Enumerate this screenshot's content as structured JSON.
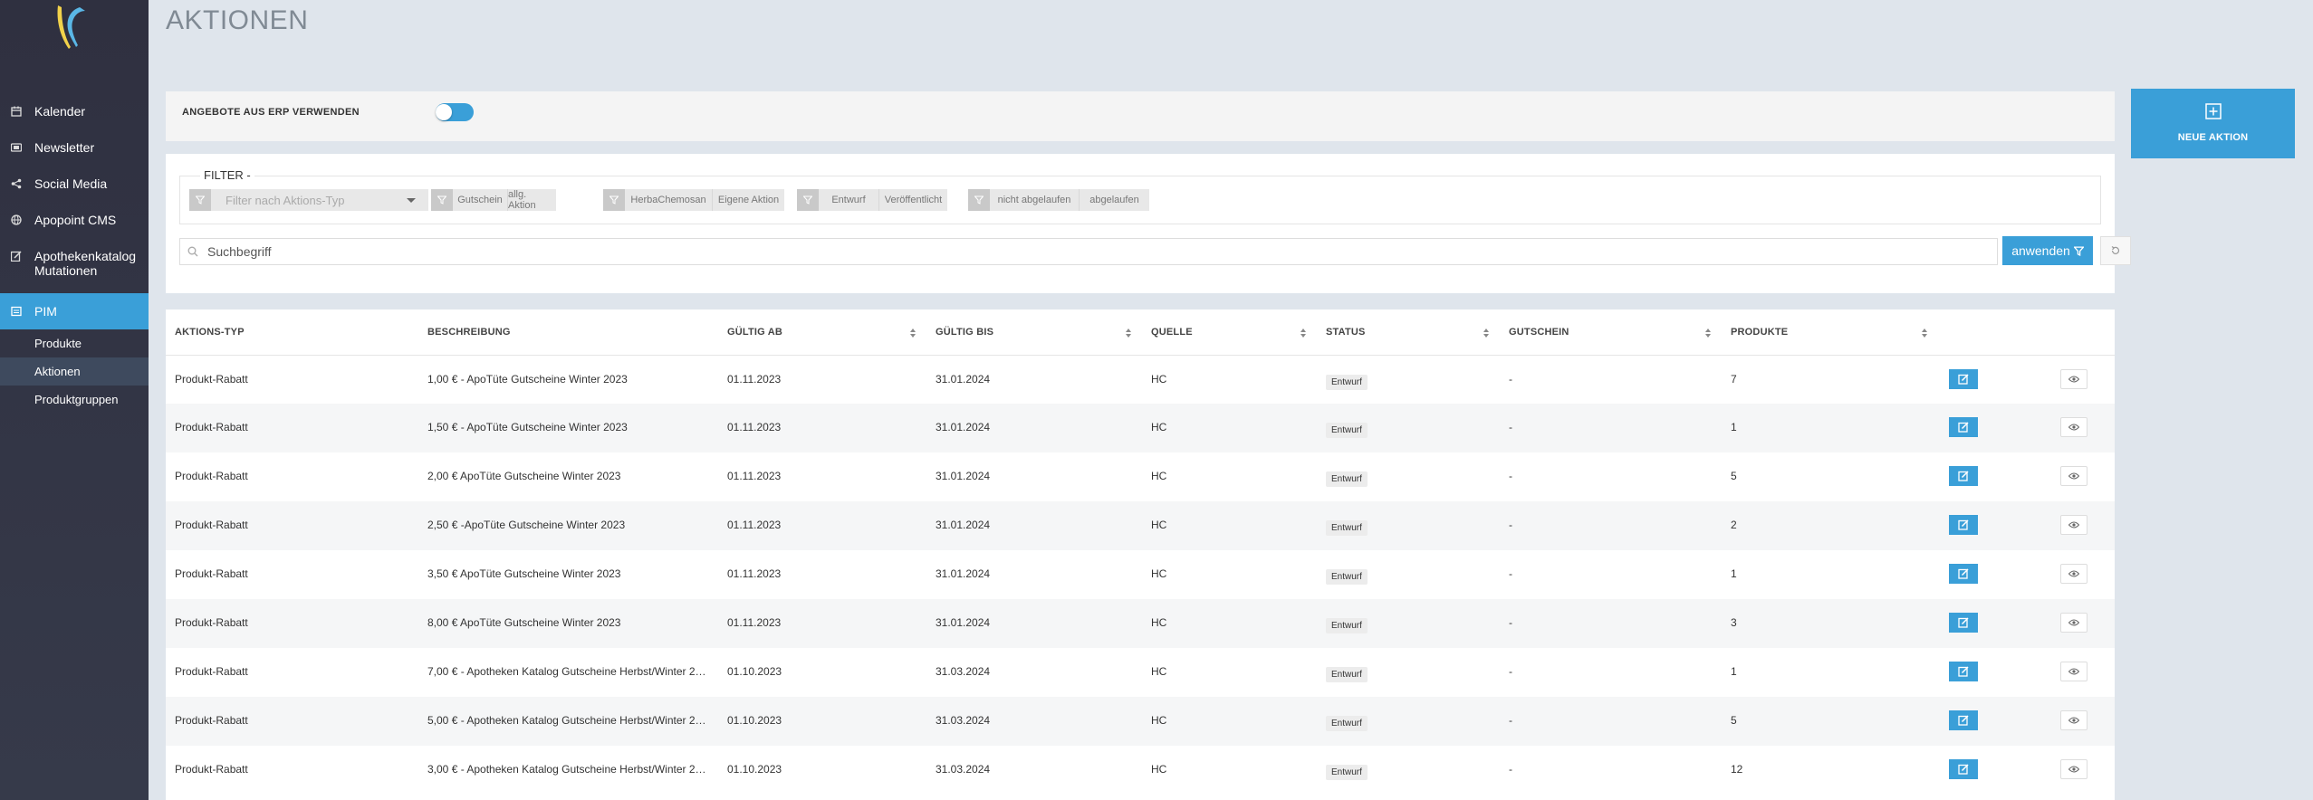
{
  "page": {
    "title": "AKTIONEN"
  },
  "sidebar": {
    "items": [
      {
        "label": "Kalender",
        "icon": "calendar-icon"
      },
      {
        "label": "Newsletter",
        "icon": "newsletter-icon"
      },
      {
        "label": "Social Media",
        "icon": "share-icon"
      },
      {
        "label": "Apopoint CMS",
        "icon": "globe-icon"
      },
      {
        "label": "Apothekenkatalog Mutationen",
        "icon": "edit-icon"
      },
      {
        "label": "PIM",
        "icon": "pim-icon",
        "active": true
      }
    ],
    "subitems": [
      {
        "label": "Produkte"
      },
      {
        "label": "Aktionen",
        "active": true
      },
      {
        "label": "Produktgruppen"
      }
    ]
  },
  "erp": {
    "label": "ANGEBOTE AUS ERP VERWENDEN",
    "enabled": true
  },
  "filter": {
    "legend": "FILTER -",
    "type_placeholder": "Filter nach Aktions-Typ",
    "groups": [
      {
        "options": [
          "Gutschein",
          "allg. Aktion"
        ]
      },
      {
        "options": [
          "HerbaChemosan",
          "Eigene Aktion"
        ]
      },
      {
        "options": [
          "Entwurf",
          "Veröffentlicht"
        ]
      },
      {
        "options": [
          "nicht abgelaufen",
          "abgelaufen"
        ]
      }
    ],
    "search_placeholder": "Suchbegriff",
    "apply_label": "anwenden"
  },
  "new_action": {
    "label": "NEUE AKTION"
  },
  "table": {
    "columns": [
      "AKTIONS-TYP",
      "BESCHREIBUNG",
      "GÜLTIG AB",
      "GÜLTIG BIS",
      "QUELLE",
      "STATUS",
      "GUTSCHEIN",
      "PRODUKTE"
    ],
    "rows": [
      {
        "typ": "Produkt-Rabatt",
        "beschreibung": "1,00 € - ApoTüte Gutscheine Winter 2023",
        "ab": "01.11.2023",
        "bis": "31.01.2024",
        "quelle": "HC",
        "status": "Entwurf",
        "gutschein": "-",
        "produkte": "7"
      },
      {
        "typ": "Produkt-Rabatt",
        "beschreibung": "1,50 € - ApoTüte Gutscheine Winter 2023",
        "ab": "01.11.2023",
        "bis": "31.01.2024",
        "quelle": "HC",
        "status": "Entwurf",
        "gutschein": "-",
        "produkte": "1"
      },
      {
        "typ": "Produkt-Rabatt",
        "beschreibung": "2,00 € ApoTüte Gutscheine Winter 2023",
        "ab": "01.11.2023",
        "bis": "31.01.2024",
        "quelle": "HC",
        "status": "Entwurf",
        "gutschein": "-",
        "produkte": "5"
      },
      {
        "typ": "Produkt-Rabatt",
        "beschreibung": "2,50 € -ApoTüte Gutscheine Winter 2023",
        "ab": "01.11.2023",
        "bis": "31.01.2024",
        "quelle": "HC",
        "status": "Entwurf",
        "gutschein": "-",
        "produkte": "2"
      },
      {
        "typ": "Produkt-Rabatt",
        "beschreibung": "3,50 € ApoTüte Gutscheine Winter 2023",
        "ab": "01.11.2023",
        "bis": "31.01.2024",
        "quelle": "HC",
        "status": "Entwurf",
        "gutschein": "-",
        "produkte": "1"
      },
      {
        "typ": "Produkt-Rabatt",
        "beschreibung": "8,00 € ApoTüte Gutscheine Winter 2023",
        "ab": "01.11.2023",
        "bis": "31.01.2024",
        "quelle": "HC",
        "status": "Entwurf",
        "gutschein": "-",
        "produkte": "3"
      },
      {
        "typ": "Produkt-Rabatt",
        "beschreibung": "7,00 € - Apotheken Katalog Gutscheine Herbst/Winter 2…",
        "ab": "01.10.2023",
        "bis": "31.03.2024",
        "quelle": "HC",
        "status": "Entwurf",
        "gutschein": "-",
        "produkte": "1"
      },
      {
        "typ": "Produkt-Rabatt",
        "beschreibung": "5,00 € - Apotheken Katalog Gutscheine Herbst/Winter 2…",
        "ab": "01.10.2023",
        "bis": "31.03.2024",
        "quelle": "HC",
        "status": "Entwurf",
        "gutschein": "-",
        "produkte": "5"
      },
      {
        "typ": "Produkt-Rabatt",
        "beschreibung": "3,00 € - Apotheken Katalog Gutscheine Herbst/Winter 2…",
        "ab": "01.10.2023",
        "bis": "31.03.2024",
        "quelle": "HC",
        "status": "Entwurf",
        "gutschein": "-",
        "produkte": "12"
      }
    ]
  },
  "colors": {
    "accent": "#3a9fd8",
    "sidebar": "#2f3040",
    "background": "#dfe5ec"
  }
}
